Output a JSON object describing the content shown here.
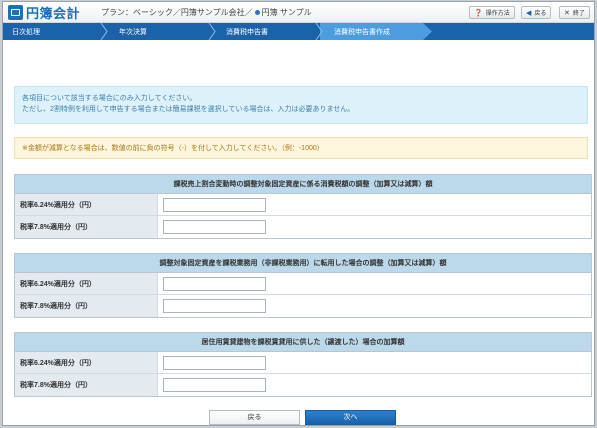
{
  "header": {
    "logo_text": "円簿会計",
    "plan_text": "プラン：ベーシック／円簿サンプル会社／",
    "user_text": "円簿 サンプル",
    "help_label": "操作方法",
    "back_label": "戻る",
    "exit_label": "終了"
  },
  "nav": {
    "steps": [
      {
        "label": "日次処理"
      },
      {
        "label": "年次決算"
      },
      {
        "label": "消費税申告書"
      },
      {
        "label": "消費税申告書作成"
      }
    ]
  },
  "notices": {
    "info_line1": "各項目について該当する場合にのみ入力してください。",
    "info_line2": "ただし、2割特例を利用して申告する場合または簡易課税を選択している場合は、入力は必要ありません。",
    "warning": "※金額が減算となる場合は、数値の前に負の符号（-）を付して入力してください。（例：-1000）"
  },
  "sections": [
    {
      "title": "課税売上割合変動時の調整対象固定資産に係る消費税額の調整（加算又は減算）額",
      "rows": [
        {
          "label": "税率6.24%適用分（円）",
          "value": ""
        },
        {
          "label": "税率7.8%適用分（円）",
          "value": ""
        }
      ]
    },
    {
      "title": "調整対象固定資産を課税業務用（非課税業務用）に転用した場合の調整（加算又は減算）額",
      "rows": [
        {
          "label": "税率6.24%適用分（円）",
          "value": ""
        },
        {
          "label": "税率7.8%適用分（円）",
          "value": ""
        }
      ]
    },
    {
      "title": "居住用賃貸建物を課税賃貸用に供した（譲渡した）場合の加算額",
      "rows": [
        {
          "label": "税率6.24%適用分（円）",
          "value": ""
        },
        {
          "label": "税率7.8%適用分（円）",
          "value": ""
        }
      ]
    }
  ],
  "footer": {
    "back_label": "戻る",
    "next_label": "次へ"
  },
  "colors": {
    "nav_bg": "#1a62aa",
    "nav_active": "#4b9de0",
    "section_title_bg": "#bcd9ec",
    "info_bg": "#ddf1fb",
    "warning_bg": "#fdf5dc"
  }
}
